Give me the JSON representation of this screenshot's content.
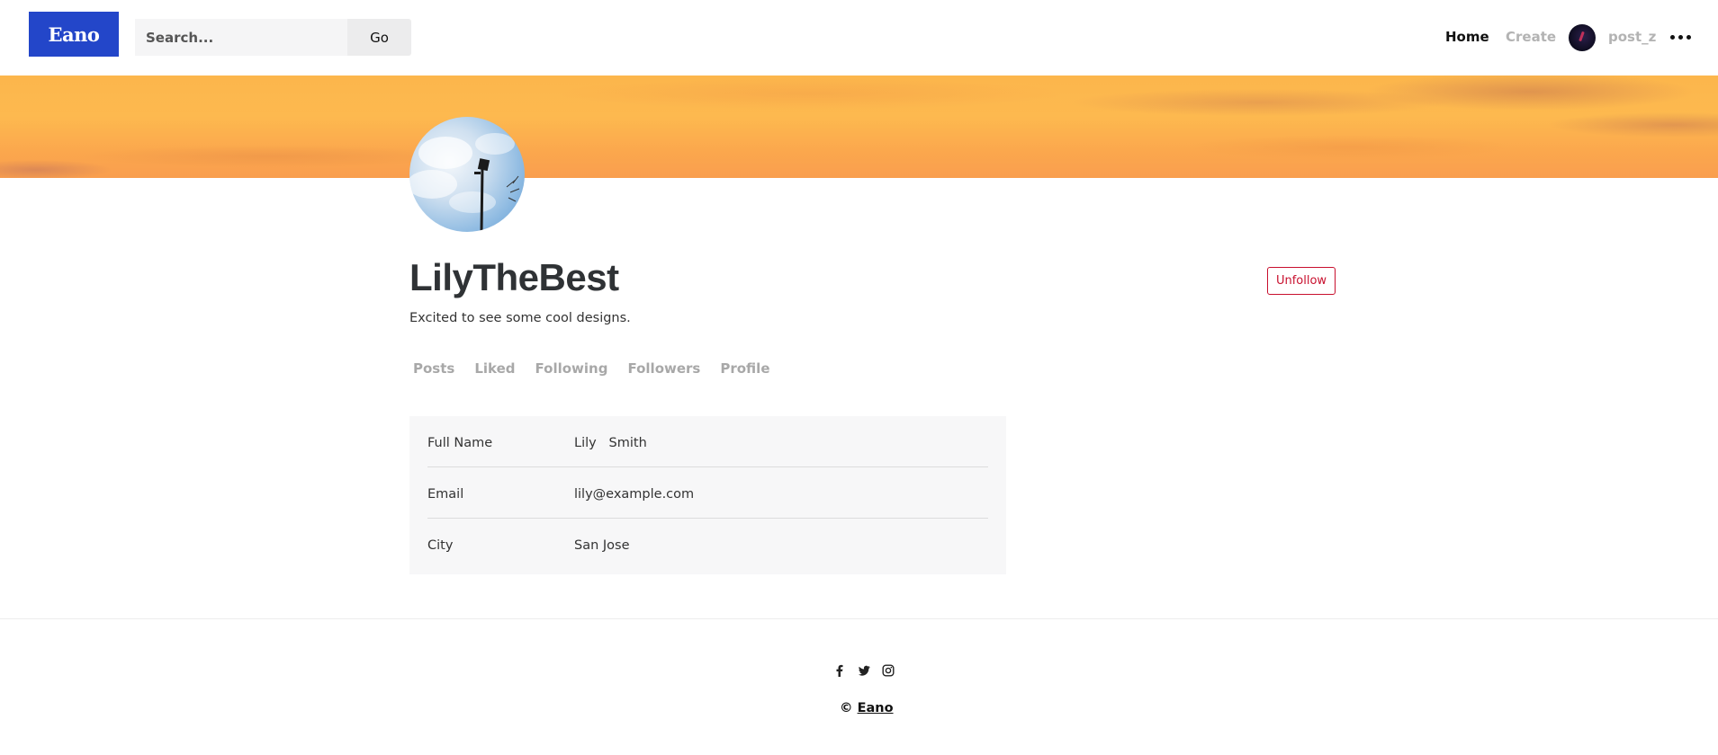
{
  "header": {
    "logo": "Eano",
    "search_placeholder": "Search...",
    "search_button": "Go",
    "nav": {
      "home": "Home",
      "create": "Create",
      "username": "post_z"
    }
  },
  "profile": {
    "name": "LilyTheBest",
    "bio": "Excited to see some cool designs.",
    "follow_button": "Unfollow",
    "tabs": [
      "Posts",
      "Liked",
      "Following",
      "Followers",
      "Profile"
    ],
    "details": [
      {
        "label": "Full Name",
        "value": "Lily   Smith"
      },
      {
        "label": "Email",
        "value": "lily@example.com"
      },
      {
        "label": "City",
        "value": "San Jose"
      }
    ]
  },
  "footer": {
    "social_icons": [
      "facebook-icon",
      "twitter-icon",
      "instagram-icon"
    ],
    "copyright_symbol": "©",
    "brand": "Eano"
  },
  "colors": {
    "brand": "#2346c9",
    "danger": "#c8102e",
    "banner": "#fcb64c"
  }
}
